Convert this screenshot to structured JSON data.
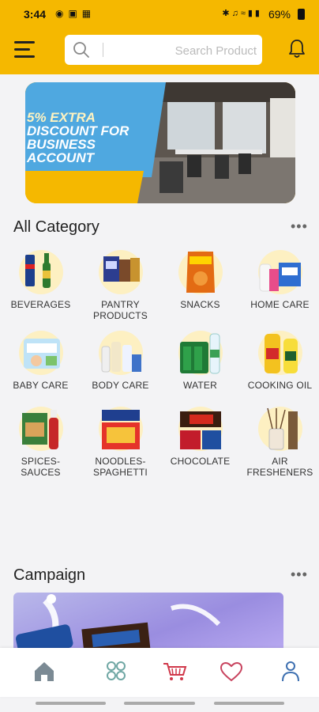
{
  "status_bar": {
    "time": "3:44",
    "battery": "69%"
  },
  "search": {
    "placeholder": "Search Product"
  },
  "banner": {
    "line1": "5% EXTRA",
    "line2": "DISCOUNT FOR",
    "line3": "BUSINESS",
    "line4": "ACCOUNT"
  },
  "all_category": {
    "title": "All Category",
    "more": "•••",
    "items": [
      {
        "label1": "BEVERAGES",
        "label2": ""
      },
      {
        "label1": "PANTRY",
        "label2": "PRODUCTS"
      },
      {
        "label1": "SNACKS",
        "label2": ""
      },
      {
        "label1": "HOME CARE",
        "label2": ""
      },
      {
        "label1": "BABY CARE",
        "label2": ""
      },
      {
        "label1": "BODY CARE",
        "label2": ""
      },
      {
        "label1": "WATER",
        "label2": ""
      },
      {
        "label1": "COOKING OIL",
        "label2": ""
      },
      {
        "label1": "SPICES-",
        "label2": "SAUCES"
      },
      {
        "label1": "NOODLES-",
        "label2": "SPAGHETTI"
      },
      {
        "label1": "CHOCOLATE",
        "label2": ""
      },
      {
        "label1": "AIR",
        "label2": "FRESHENERS"
      }
    ]
  },
  "campaign": {
    "title": "Campaign",
    "more": "•••"
  },
  "bottom_nav": [
    "home-icon",
    "grid-icon",
    "cart-icon",
    "heart-icon",
    "profile-icon"
  ],
  "colors": {
    "accent": "#f5b800",
    "promo_blue": "#4fa8e0",
    "nav_icon": "#7b8a94",
    "cart": "#d0384a",
    "heart": "#c8435e",
    "profile": "#3d6fb0"
  }
}
